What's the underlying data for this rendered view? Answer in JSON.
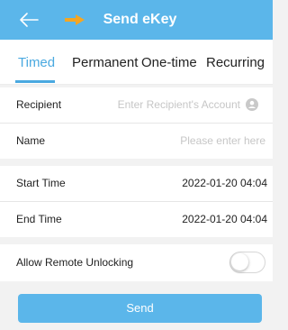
{
  "header": {
    "title": "Send eKey",
    "back_icon": "back-arrow-icon",
    "annotation_icon": "orange-arrow-icon",
    "background": "#5bb6ea",
    "annotation_color": "#f5a623"
  },
  "tabs": {
    "items": [
      {
        "label": "Timed",
        "active": true
      },
      {
        "label": "Permanent",
        "active": false
      },
      {
        "label": "One-time",
        "active": false
      },
      {
        "label": "Recurring",
        "active": false
      }
    ],
    "active_color": "#4aa9e0"
  },
  "form": {
    "recipient": {
      "label": "Recipient",
      "placeholder": "Enter Recipient's Account",
      "icon": "account-icon"
    },
    "name": {
      "label": "Name",
      "placeholder": "Please enter here"
    },
    "start_time": {
      "label": "Start Time",
      "value": "2022-01-20 04:04"
    },
    "end_time": {
      "label": "End Time",
      "value": "2022-01-20 04:04"
    },
    "remote_unlock": {
      "label": "Allow Remote Unlocking",
      "enabled": false
    }
  },
  "send_button": {
    "label": "Send",
    "background": "#5bb6ea"
  }
}
